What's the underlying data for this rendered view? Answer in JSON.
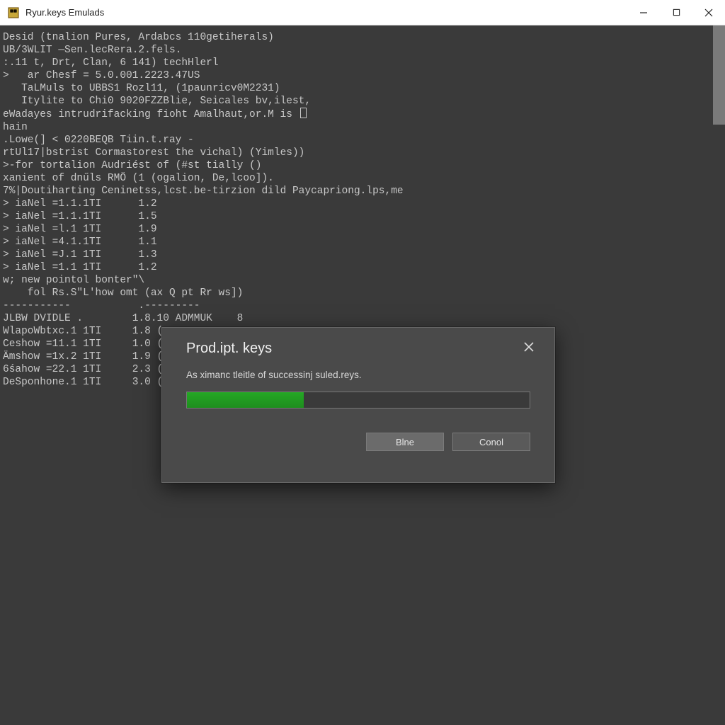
{
  "titlebar": {
    "title": "Ryur.keys Emulads"
  },
  "terminal": {
    "lines": [
      "Desid (tnalion Pures, Ardabcs 110getiherals)",
      "UB/3WLIT —Sen.lecRera.2.fels.",
      ":.11 t, Drt, Clan, 6 141) techHlerl",
      ">   ar Chesf = 5.0.001.2223.47US",
      "   TaLMuls to UBBS1 Rozl11, (1paunricv0M2231)",
      "   Itylite to Chi0 9020FZZBlie, Seicales bv,ilest,",
      "",
      "eWadayes intrudrifacking fioht Amalhaut,or.M is ",
      "hain",
      ".Lowe(] < 0220BEQB Tiin.t.ray -",
      "rtUl17|bstrist Cormastorest the vichal) (Yimles))",
      ">-for tortalion Audriést of (#st tially ()",
      "xanient of dnűls RMÖ (1 (ogalion, De,lcoo]).",
      "7%|Doutiharting Ceninetss,lcst.be-tirzion dild Paycapriong.lps,me",
      "",
      "> iaNel =1.1.1TI      1.2",
      "> iaNel =1.1.1TI      1.5",
      "> iaNel =l.1 1TI      1.9",
      "> iaNel =4.1.1TI      1.1",
      "> iaNel =J.1 1TI      1.3",
      "> iaNel =1.1 1TI      1.2",
      "",
      "w; new pointol bonter\"\\",
      "    fol Rs.S\"L'how omt (ax Q pt Rr ws])",
      "-----------           .---------",
      "JLBW DVIDLE .        1.8.10 ADMMUK    8",
      "WlapoWbtxc.1 1TI     1.8 (",
      "Ceshow =11.1 1TI     1.0 (",
      "Ämshow =1x.2 1TI     1.9 (",
      "6śahow =22.1 1TI     2.3 (",
      "DeSponhone.1 1TI     3.0 ("
    ],
    "cursor_line_index": 7
  },
  "dialog": {
    "title": "Prod.ipt. keys",
    "message": "As ximanc tleitle of successinj suled.reys.",
    "progress_percent": 34,
    "primary_label": "Blne",
    "secondary_label": "Conol"
  },
  "colors": {
    "progress_green": "#25a825"
  }
}
